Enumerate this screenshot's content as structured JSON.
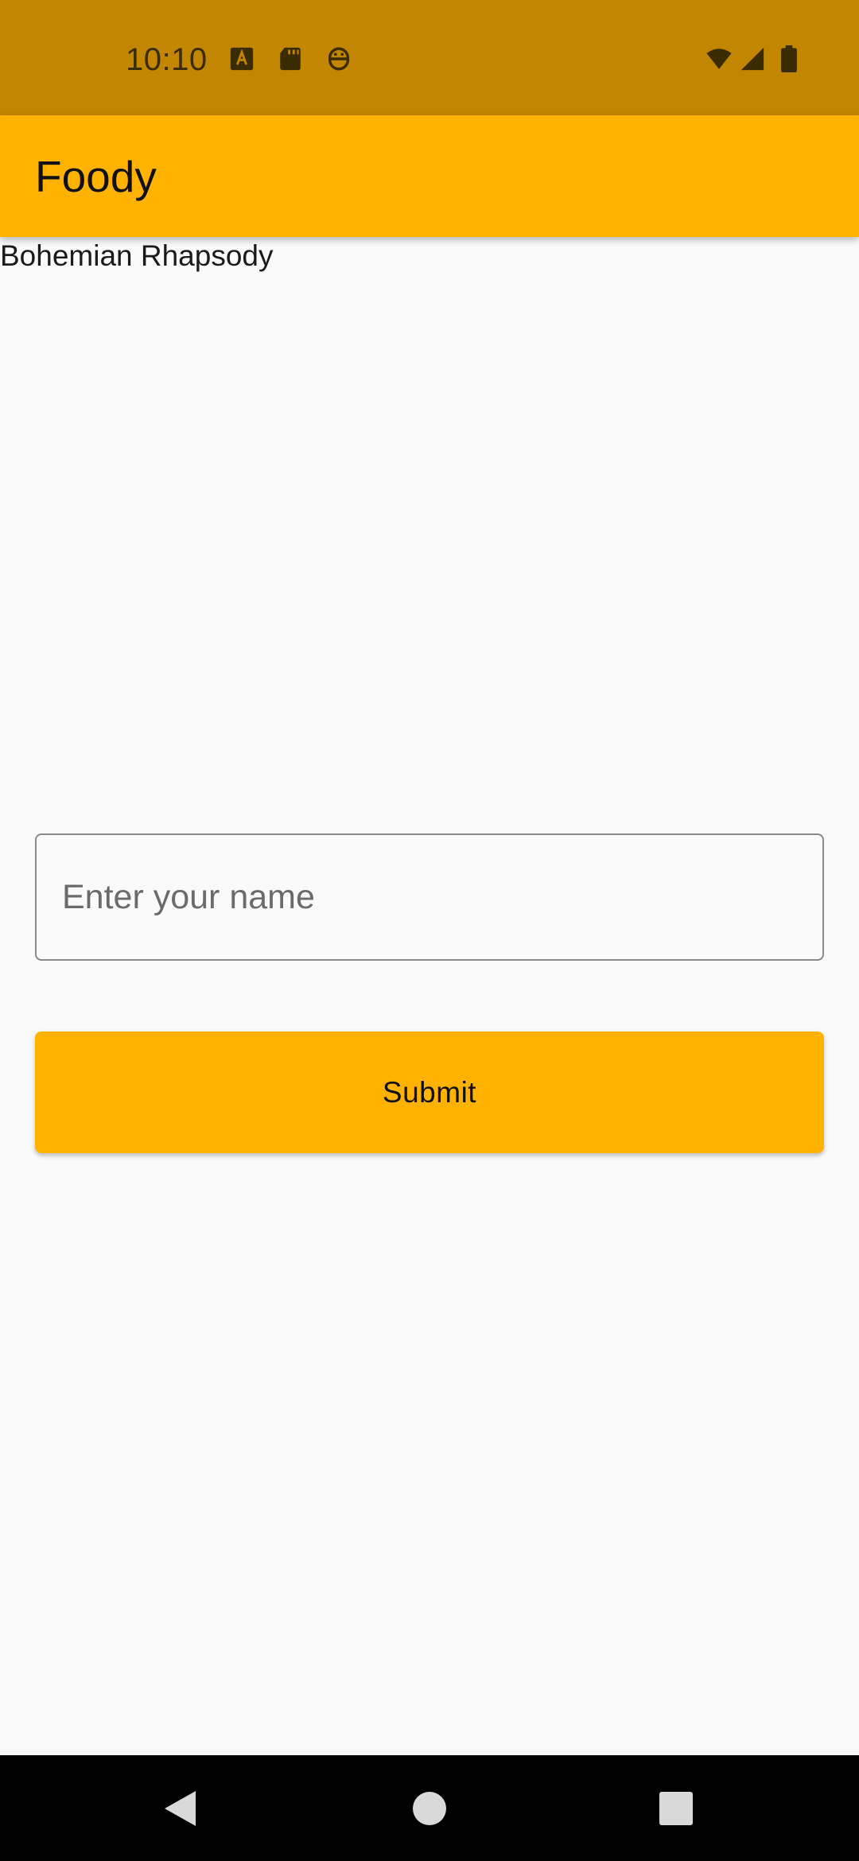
{
  "status_bar": {
    "time": "10:10",
    "left_icons": [
      "a-badge-icon",
      "sd-card-icon",
      "robot-face-icon"
    ],
    "right_icons": [
      "wifi-icon",
      "cell-signal-icon",
      "battery-icon"
    ]
  },
  "app_bar": {
    "title": "Foody"
  },
  "content": {
    "song_text": "Bohemian Rhapsody"
  },
  "form": {
    "name_placeholder": "Enter your name",
    "name_value": "",
    "submit_label": "Submit"
  },
  "nav_bar": {
    "buttons": [
      "back-icon",
      "home-icon",
      "recents-icon"
    ]
  },
  "colors": {
    "status_bar": "#C28600",
    "primary": "#FFB300",
    "background": "#FAFAFA"
  }
}
